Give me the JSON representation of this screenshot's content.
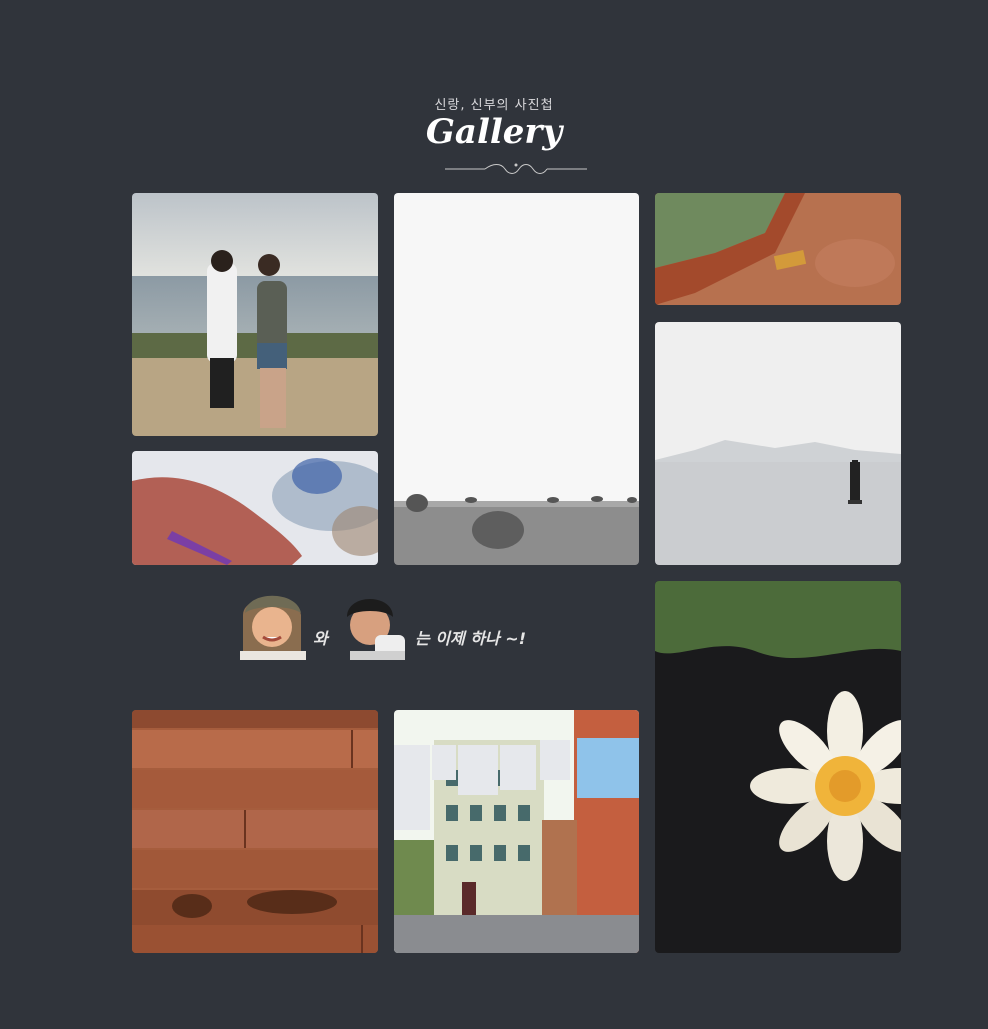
{
  "gallery": {
    "subtitle": "신랑, 신부의 사진첩",
    "title": "Gallery"
  },
  "caption": {
    "conjunction": "와",
    "rest": "는 이제 하나 ~!"
  },
  "photos": [
    {
      "name": "photo-couple-beach"
    },
    {
      "name": "photo-hay-bales"
    },
    {
      "name": "photo-autumn-leaves"
    },
    {
      "name": "photo-hand-closeup"
    },
    {
      "name": "photo-sea-buoy"
    },
    {
      "name": "photo-water-lily"
    },
    {
      "name": "photo-wood-planks"
    },
    {
      "name": "photo-laundry-street"
    }
  ],
  "colors": {
    "background": "#30343b",
    "title": "#ffffff",
    "subtitle": "#d9d9dc"
  }
}
